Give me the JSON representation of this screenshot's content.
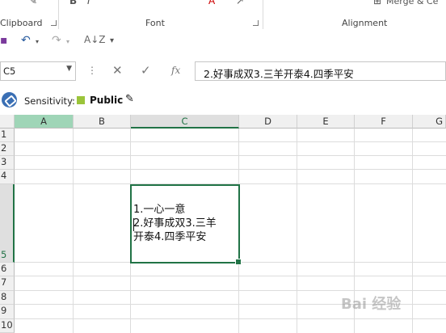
{
  "ribbon": {
    "groups": [
      {
        "label": "Clipboard"
      },
      {
        "label": "Font"
      },
      {
        "label": "Alignment"
      }
    ],
    "merge_label": "Merge & Ce"
  },
  "qat": {
    "icons": [
      "save-icon",
      "undo-icon",
      "redo-icon",
      "sort-icon",
      "customize-icon"
    ]
  },
  "formula_bar": {
    "name_box": "C5",
    "fx_label": "fx",
    "content": "2.好事成双3.三羊开泰4.四季平安"
  },
  "sensitivity": {
    "label": "Sensitivity:",
    "value": "Public",
    "color": "#9bc43a"
  },
  "grid": {
    "columns": [
      "A",
      "B",
      "C",
      "D",
      "E",
      "F",
      "G"
    ],
    "rows": [
      "1",
      "2",
      "3",
      "4",
      "5",
      "6",
      "7",
      "8",
      "9",
      "10"
    ],
    "selected_cell": "C5",
    "cell_text": "1.一心一意\n2.好事成双3.三羊\n开泰4.四季平安"
  },
  "watermark": "Bai 经验",
  "accent_color": "#217346"
}
